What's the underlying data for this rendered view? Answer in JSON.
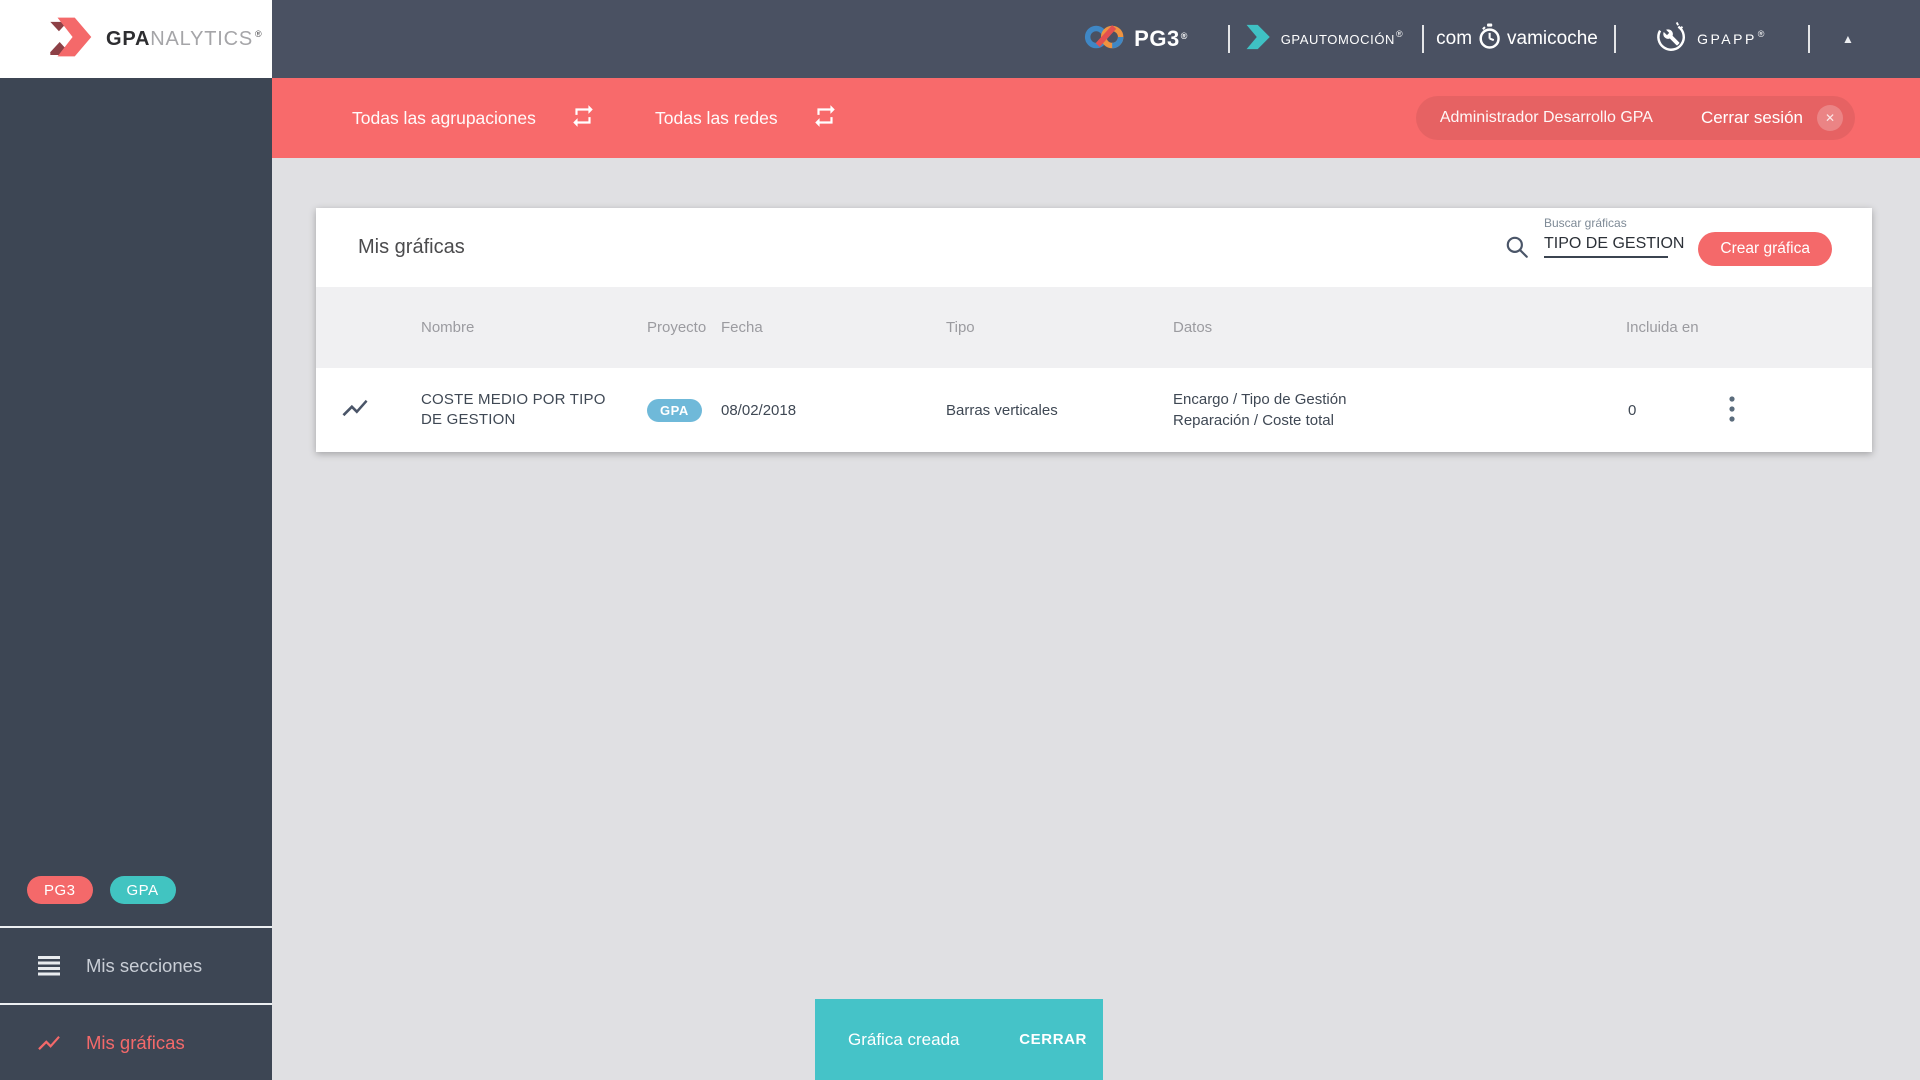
{
  "app": {
    "logo_bold": "GPA",
    "logo_light": "NALYTICS",
    "logo_reg": "®"
  },
  "topbar": {
    "pg3_label": "PG3",
    "pg3_reg": "®",
    "automocion_label": "GPAUTOMOCIÓN",
    "automocion_reg": "®",
    "coche_prefix": "com",
    "coche_suffix": "vamicoche",
    "gpapp_label": "GPAPP",
    "gpapp_reg": "®",
    "collapse_icon": "▲"
  },
  "filterbar": {
    "groupings_label": "Todas las agrupaciones",
    "networks_label": "Todas las redes",
    "user_name": "Administrador Desarrollo GPA",
    "logout_label": "Cerrar sesión",
    "logout_close_icon": "✕"
  },
  "sidebar": {
    "badge_pg3": "PG3",
    "badge_gpa": "GPA",
    "sections_label": "Mis secciones",
    "charts_label": "Mis gráficas"
  },
  "content": {
    "title": "Mis gráficas",
    "search_label": "Buscar gráficas",
    "search_value": "TIPO DE GESTION",
    "create_button_label": "Crear gráfica",
    "table": {
      "columns": [
        "Nombre",
        "Proyecto",
        "Fecha",
        "Tipo",
        "Datos",
        "Incluida en"
      ],
      "rows": [
        {
          "nombre": "COSTE MEDIO POR TIPO DE GESTION",
          "proyecto_badge": "GPA",
          "fecha": "08/02/2018",
          "tipo": "Barras verticales",
          "datos_line1": "Encargo / Tipo de Gestión",
          "datos_line2": "Reparación / Coste total",
          "incluida_en": "0"
        }
      ]
    }
  },
  "snackbar": {
    "message": "Gráfica creada",
    "action_label": "CERRAR"
  },
  "colors": {
    "accent_red": "#f4696a",
    "bar_red": "#f86a6b",
    "accent_teal": "#45c3c8",
    "badge_blue": "#6fb9d9",
    "header_dark": "#4a5162",
    "sidebar_dark": "#3d4654"
  }
}
